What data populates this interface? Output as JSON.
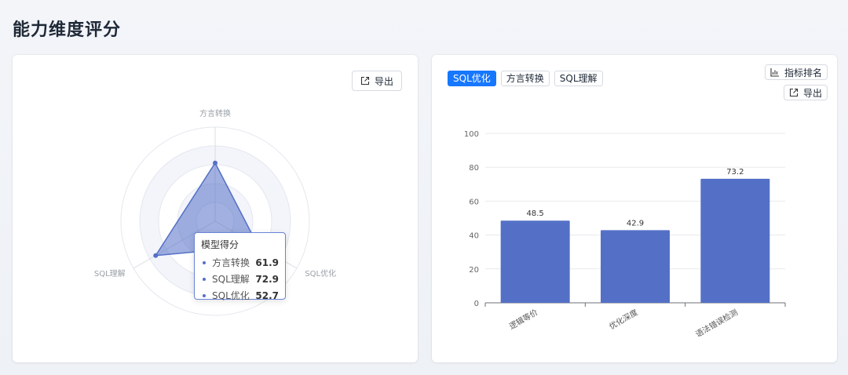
{
  "page": {
    "title": "能力维度评分"
  },
  "left": {
    "export_label": "导出",
    "tooltip": {
      "title": "模型得分",
      "rows": [
        {
          "name": "方言转换",
          "value": "61.9"
        },
        {
          "name": "SQL理解",
          "value": "72.9"
        },
        {
          "name": "SQL优化",
          "value": "52.7"
        }
      ]
    }
  },
  "right": {
    "tabs": [
      {
        "label": "SQL优化",
        "active": true
      },
      {
        "label": "方言转换",
        "active": false
      },
      {
        "label": "SQL理解",
        "active": false
      }
    ],
    "rank_label": "指标排名",
    "export_label": "导出"
  },
  "colors": {
    "accent": "#1677ff",
    "series": "#5470c6"
  },
  "chart_data": [
    {
      "type": "radar",
      "indicators": [
        "方言转换",
        "SQL优化",
        "SQL理解"
      ],
      "max": 100,
      "series": [
        {
          "name": "模型得分",
          "values": [
            61.9,
            52.7,
            72.9
          ]
        }
      ],
      "grid": true
    },
    {
      "type": "bar",
      "categories": [
        "逻辑等价",
        "优化深度",
        "语法错误检测"
      ],
      "values": [
        48.5,
        42.9,
        73.2
      ],
      "data_labels": [
        "48.5",
        "42.9",
        "73.2"
      ],
      "ylim": [
        0,
        100
      ],
      "yticks": [
        0,
        20,
        40,
        60,
        80,
        100
      ],
      "grid": true
    }
  ]
}
